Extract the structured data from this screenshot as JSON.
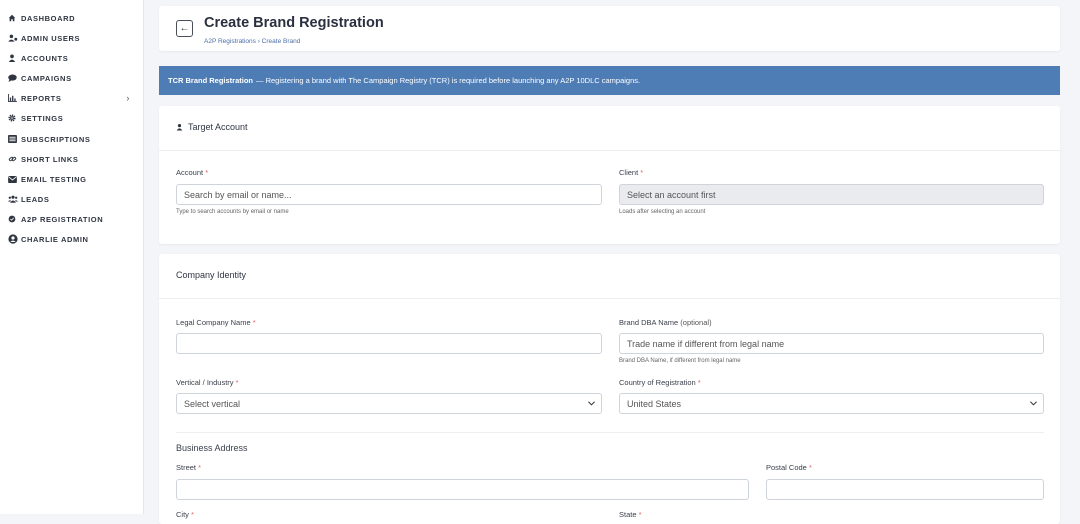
{
  "sidebar": {
    "items": [
      {
        "label": "DASHBOARD",
        "icon": "home-icon"
      },
      {
        "label": "ADMIN USERS",
        "icon": "users-cog-icon"
      },
      {
        "label": "ACCOUNTS",
        "icon": "user-icon"
      },
      {
        "label": "CAMPAIGNS",
        "icon": "comment-icon"
      },
      {
        "label": "REPORTS",
        "icon": "bar-chart-icon",
        "chevron": "›"
      },
      {
        "label": "SETTINGS",
        "icon": "gear-icon"
      },
      {
        "label": "SUBSCRIPTIONS",
        "icon": "list-icon"
      },
      {
        "label": "SHORT LINKS",
        "icon": "link-icon"
      },
      {
        "label": "EMAIL TESTING",
        "icon": "envelope-icon"
      },
      {
        "label": "LEADS",
        "icon": "people-icon"
      },
      {
        "label": "A2P REGISTRATION",
        "icon": "badge-icon"
      },
      {
        "label": "CHARLIE ADMIN",
        "icon": "user-circle-icon"
      }
    ]
  },
  "header": {
    "back_icon": "←",
    "title": "Create Brand Registration",
    "breadcrumb": "A2P Registrations › Create Brand"
  },
  "banner": {
    "strong": "TCR Brand Registration",
    "text": "— Registering a brand with The Campaign Registry (TCR) is required before launching any A2P 10DLC campaigns.",
    "color": "#4e7cb5"
  },
  "target_account": {
    "title": "Target Account",
    "account": {
      "label": "Account",
      "required": "*",
      "placeholder": "Search by email or name...",
      "help": "Type to search accounts by email or name"
    },
    "client": {
      "label": "Client",
      "required": "*",
      "placeholder": "Select an account first",
      "help": "Loads after selecting an account"
    }
  },
  "company_identity": {
    "title": "Company Identity",
    "legal_name": {
      "label": "Legal Company Name",
      "required": "*",
      "value": ""
    },
    "dba_name": {
      "label": "Brand DBA Name",
      "optional": "(optional)",
      "placeholder": "Trade name if different from legal name",
      "help": "Brand DBA Name, if different from legal name"
    },
    "vertical": {
      "label": "Vertical / Industry",
      "required": "*",
      "selected": "Select vertical"
    },
    "country": {
      "label": "Country of Registration",
      "required": "*",
      "selected": "United States"
    },
    "address_title": "Business Address",
    "street": {
      "label": "Street",
      "required": "*",
      "value": ""
    },
    "postal_code": {
      "label": "Postal Code",
      "required": "*",
      "value": ""
    },
    "city": {
      "label": "City",
      "required": "*"
    },
    "state": {
      "label": "State",
      "required": "*"
    }
  }
}
